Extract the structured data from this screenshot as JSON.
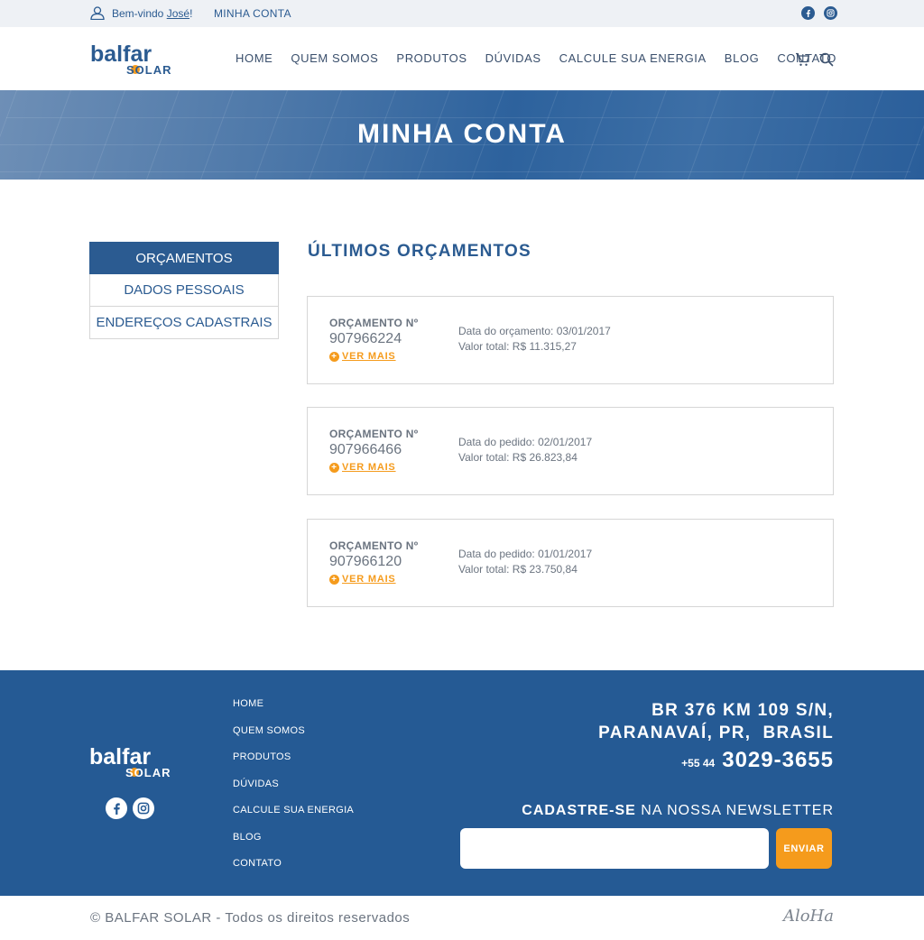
{
  "topbar": {
    "welcome_prefix": "Bem-vindo",
    "user_name": "José",
    "welcome_suffix": "!",
    "account_link": "MINHA CONTA"
  },
  "header": {
    "logo_top": "balfar",
    "logo_bottom": "SOLAR",
    "nav": [
      "HOME",
      "QUEM SOMOS",
      "PRODUTOS",
      "DÚVIDAS",
      "CALCULE SUA ENERGIA",
      "BLOG",
      "CONTATO"
    ]
  },
  "banner": {
    "title": "MINHA CONTA"
  },
  "sidebar": {
    "items": [
      {
        "label": "ORÇAMENTOS",
        "active": true
      },
      {
        "label": "DADOS PESSOAIS",
        "active": false
      },
      {
        "label": "ENDEREÇOS CADASTRAIS",
        "active": false
      }
    ]
  },
  "main": {
    "title": "ÚLTIMOS ORÇAMENTOS",
    "quotes": [
      {
        "label": "ORÇAMENTO Nº",
        "number": "907966224",
        "more": "VER MAIS",
        "date": "Data do orçamento: 03/01/2017",
        "total": "Valor total: R$ 11.315,27"
      },
      {
        "label": "ORÇAMENTO Nº",
        "number": "907966466",
        "more": "VER MAIS",
        "date": "Data do pedido: 02/01/2017",
        "total": "Valor total: R$ 26.823,84"
      },
      {
        "label": "ORÇAMENTO Nº",
        "number": "907966120",
        "more": "VER MAIS",
        "date": "Data do pedido: 01/01/2017",
        "total": "Valor total: R$ 23.750,84"
      }
    ]
  },
  "footer": {
    "nav": [
      "HOME",
      "QUEM SOMOS",
      "PRODUTOS",
      "DÚVIDAS",
      "CALCULE SUA ENERGIA",
      "BLOG",
      "CONTATO"
    ],
    "address_line1": "BR 376 KM 109 S/N,",
    "address_line2": "PARANAVAÍ, PR,  BRASIL",
    "phone_ddd": "+55 44",
    "phone": "3029-3655",
    "newsletter_bold": "CADASTRE-SE",
    "newsletter_rest": "NA NOSSA NEWSLETTER",
    "newsletter_button": "ENVIAR"
  },
  "bottom": {
    "copyright": "© BALFAR SOLAR - Todos os direitos reservados",
    "agency": "AloHa"
  },
  "colors": {
    "brand_blue": "#2b5b91",
    "accent_orange": "#f59b1c",
    "footer_blue": "#255a94"
  }
}
